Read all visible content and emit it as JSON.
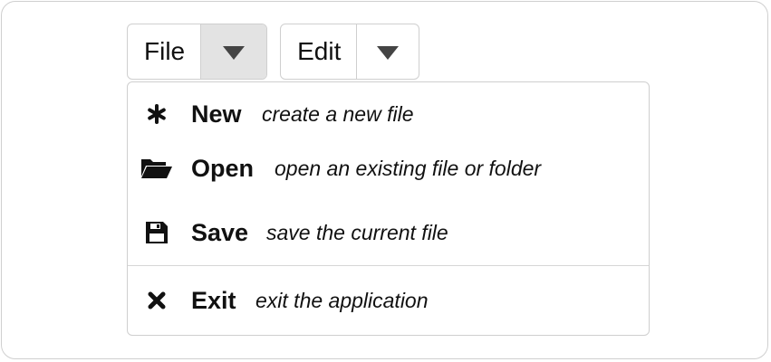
{
  "menubar": {
    "file": {
      "label": "File",
      "caret_active": true
    },
    "edit": {
      "label": "Edit",
      "caret_active": false
    }
  },
  "dropdown": {
    "items": [
      {
        "icon": "asterisk-icon",
        "name": "New",
        "description": "create a new file"
      },
      {
        "icon": "folder-open-icon",
        "name": "Open",
        "description": "open an existing file or folder"
      },
      {
        "icon": "save-icon",
        "name": "Save",
        "description": "save the current file"
      },
      {
        "icon": "close-icon",
        "name": "Exit",
        "description": "exit the application"
      }
    ]
  },
  "colors": {
    "border": "#cfcfcf",
    "active_caret_bg": "#e3e3e3",
    "text": "#111111",
    "caret": "#444444"
  }
}
